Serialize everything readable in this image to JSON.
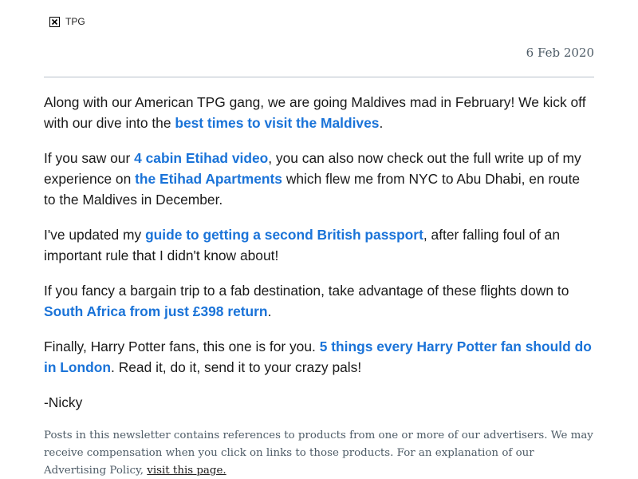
{
  "header": {
    "logo_alt": "TPG",
    "date": "6 Feb 2020"
  },
  "content": {
    "p1": {
      "before": "Along with our American TPG gang, we are going Maldives mad in February! We kick off with our dive into the ",
      "link": "best times to visit the Maldives",
      "after": "."
    },
    "p2": {
      "before": "If you saw our ",
      "link1": "4 cabin Etihad video",
      "middle": ", you can also now check out the full write up of my experience on ",
      "link2": "the Etihad Apartments",
      "after": " which flew me from NYC to Abu Dhabi, en route to the Maldives in December."
    },
    "p3": {
      "before": "I've updated my ",
      "link": "guide to getting a second British passport",
      "after": ", after falling foul of an important rule that I didn't know about!"
    },
    "p4": {
      "before": "If you fancy a bargain trip to a fab destination, take advantage of these flights down to ",
      "link": "South Africa from just £398 return",
      "after": "."
    },
    "p5": {
      "before": "Finally, Harry Potter fans, this one is for you. ",
      "link": "5 things every Harry Potter fan should do in London",
      "after": ". Read it, do it, send it to your crazy pals!"
    },
    "signoff": "-Nicky"
  },
  "footer": {
    "text": "Posts in this newsletter contains references to products from one or more of our advertisers. We may receive compensation when you click on links to those products. For an explanation of our Advertising Policy, ",
    "link": "visit this page."
  },
  "colors": {
    "link": "#1a73d8",
    "body_text": "#1a1a1a",
    "muted_text": "#4d5b66",
    "divider": "#b7c0ca"
  }
}
